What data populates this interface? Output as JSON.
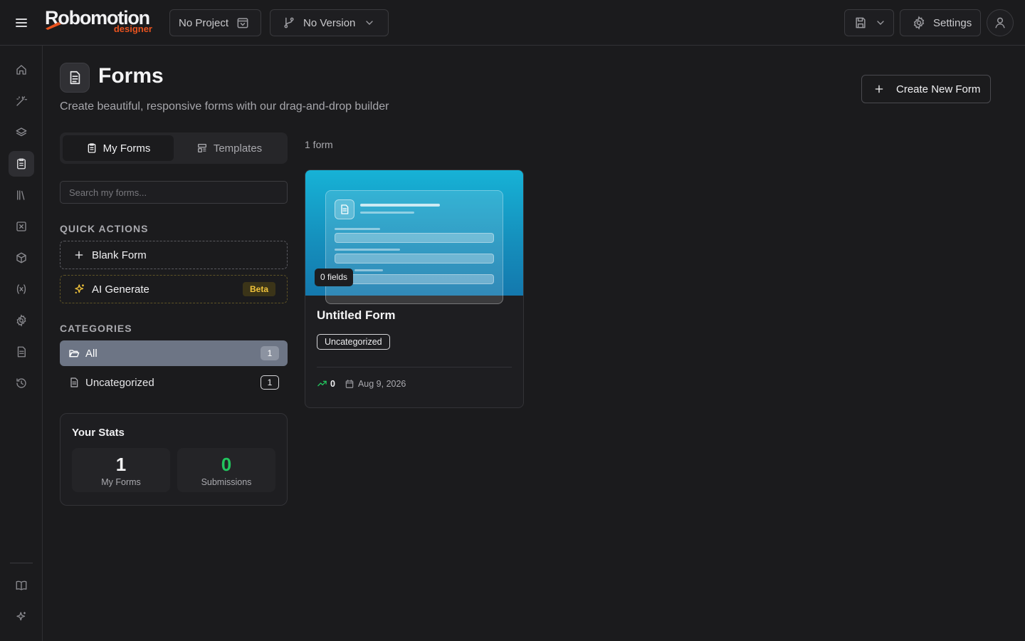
{
  "app": {
    "logo_word": "Robomotion",
    "logo_sub": "designer",
    "brand_color": "#e8531f"
  },
  "topbar": {
    "project_label": "No Project",
    "version_label": "No Version",
    "settings_label": "Settings"
  },
  "sidebar": {
    "items": [
      {
        "icon": "home-icon",
        "active": false
      },
      {
        "icon": "magic-wand-icon",
        "active": false
      },
      {
        "icon": "layers-icon",
        "active": false
      },
      {
        "icon": "clipboard-icon",
        "active": true
      },
      {
        "icon": "library-icon",
        "active": false
      },
      {
        "icon": "x-square-icon",
        "active": false
      },
      {
        "icon": "package-icon",
        "active": false
      },
      {
        "icon": "variable-icon",
        "active": false
      },
      {
        "icon": "gear-icon",
        "active": false
      },
      {
        "icon": "document-icon",
        "active": false
      },
      {
        "icon": "history-icon",
        "active": false
      }
    ],
    "bottom": [
      {
        "icon": "book-icon"
      },
      {
        "icon": "sparkles-icon"
      }
    ]
  },
  "page": {
    "title": "Forms",
    "subtitle": "Create beautiful, responsive forms with our drag-and-drop builder",
    "create_button": "Create New Form"
  },
  "tabs": [
    {
      "label": "My Forms",
      "active": true
    },
    {
      "label": "Templates",
      "active": false
    }
  ],
  "search": {
    "placeholder": "Search my forms...",
    "value": ""
  },
  "quick_actions": {
    "heading": "QUICK ACTIONS",
    "blank_label": "Blank Form",
    "ai_label": "AI Generate",
    "ai_badge": "Beta"
  },
  "categories": {
    "heading": "CATEGORIES",
    "items": [
      {
        "label": "All",
        "count": "1",
        "active": true
      },
      {
        "label": "Uncategorized",
        "count": "1",
        "active": false
      }
    ]
  },
  "stats": {
    "title": "Your Stats",
    "my_forms_value": "1",
    "my_forms_label": "My Forms",
    "submissions_value": "0",
    "submissions_label": "Submissions",
    "submissions_color": "#22c55e"
  },
  "forms_list": {
    "count_text": "1 form",
    "cards": [
      {
        "fields_badge": "0 fields",
        "title": "Untitled Form",
        "category": "Uncategorized",
        "submissions": "0",
        "date": "Aug 9, 2026"
      }
    ]
  }
}
